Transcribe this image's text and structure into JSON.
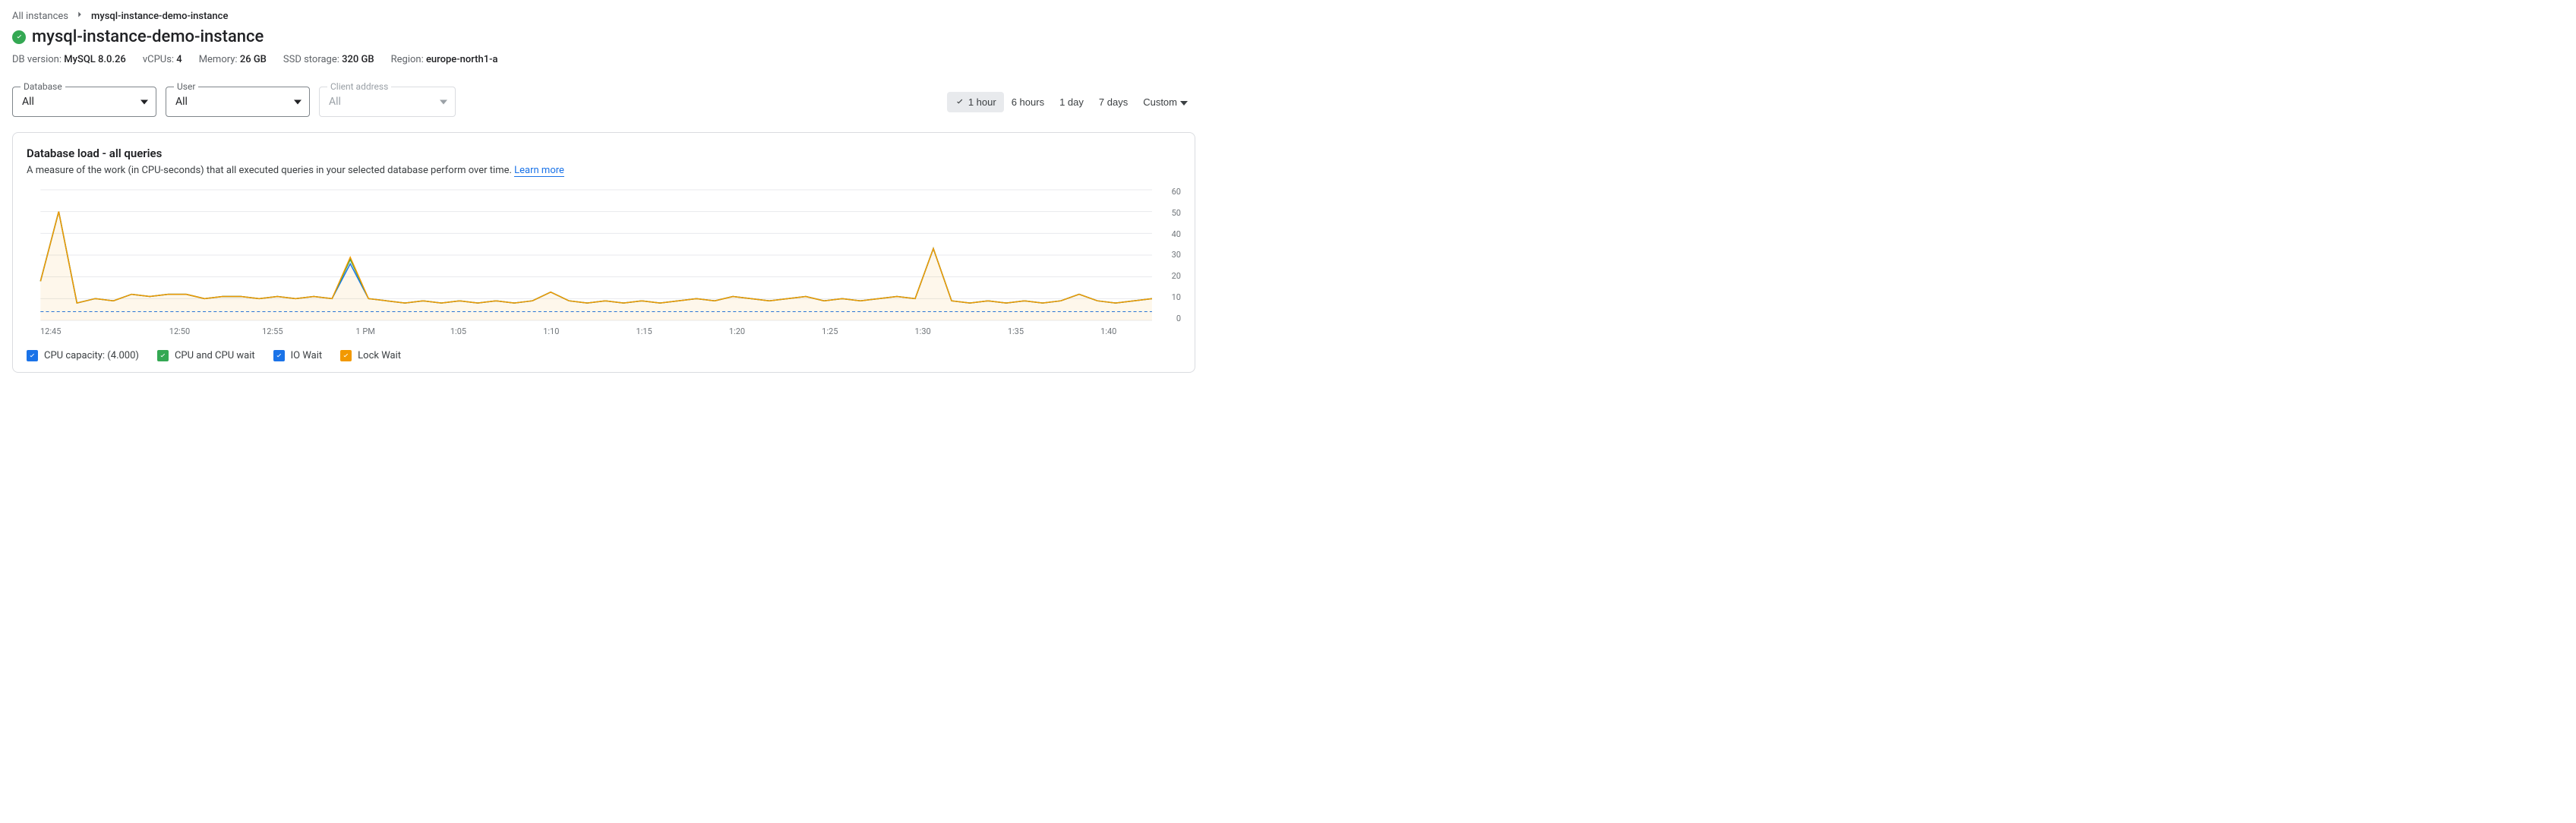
{
  "breadcrumb": {
    "root": "All instances",
    "current": "mysql-instance-demo-instance"
  },
  "title": "mysql-instance-demo-instance",
  "specs": {
    "db_version_label": "DB version:",
    "db_version": "MySQL 8.0.26",
    "vcpus_label": "vCPUs:",
    "vcpus": "4",
    "memory_label": "Memory:",
    "memory": "26 GB",
    "ssd_label": "SSD storage:",
    "ssd": "320 GB",
    "region_label": "Region:",
    "region": "europe-north1-a"
  },
  "filters": {
    "database": {
      "label": "Database",
      "value": "All"
    },
    "user": {
      "label": "User",
      "value": "All"
    },
    "client": {
      "label": "Client address",
      "value": "All"
    }
  },
  "time_ranges": [
    "1 hour",
    "6 hours",
    "1 day",
    "7 days",
    "Custom"
  ],
  "time_range_active": "1 hour",
  "card": {
    "title": "Database load - all queries",
    "desc": "A measure of the work (in CPU-seconds) that all executed queries in your selected database perform over time. ",
    "learn_more": "Learn more"
  },
  "legend": [
    {
      "label": "CPU capacity: (4.000)",
      "color": "#1a73e8"
    },
    {
      "label": "CPU and CPU wait",
      "color": "#34a853"
    },
    {
      "label": "IO Wait",
      "color": "#1a73e8"
    },
    {
      "label": "Lock Wait",
      "color": "#f29900"
    }
  ],
  "chart_data": {
    "type": "area",
    "xlabel": "",
    "ylabel": "",
    "ylim": [
      0,
      60
    ],
    "y_ticks": [
      60,
      50,
      40,
      30,
      20,
      10,
      0
    ],
    "x_ticks": [
      "12:45",
      "12:50",
      "12:55",
      "1 PM",
      "1:05",
      "1:10",
      "1:15",
      "1:20",
      "1:25",
      "1:30",
      "1:35",
      "1:40"
    ],
    "cpu_capacity": 4.0,
    "series": [
      {
        "name": "Lock Wait",
        "color": "#f29900",
        "fill": "rgba(242,153,0,0.08)",
        "values": [
          18,
          50,
          8,
          10,
          9,
          12,
          11,
          12,
          12,
          10,
          11,
          11,
          10,
          11,
          10,
          11,
          10,
          29,
          10,
          9,
          8,
          9,
          8,
          9,
          8,
          9,
          8,
          9,
          13,
          9,
          8,
          9,
          8,
          9,
          8,
          9,
          10,
          9,
          11,
          10,
          9,
          10,
          11,
          9,
          10,
          9,
          10,
          11,
          10,
          33,
          9,
          8,
          9,
          8,
          9,
          8,
          9,
          12,
          9,
          8,
          9,
          10
        ]
      },
      {
        "name": "CPU and CPU wait",
        "color": "#34a853",
        "values": [
          18,
          50,
          8,
          10,
          9,
          12,
          11,
          12,
          12,
          10,
          11,
          11,
          10,
          11,
          10,
          11,
          10,
          28,
          10,
          9,
          8,
          9,
          8,
          9,
          8,
          9,
          8,
          9,
          13,
          9,
          8,
          9,
          8,
          9,
          8,
          9,
          10,
          9,
          11,
          10,
          9,
          10,
          11,
          9,
          10,
          9,
          10,
          11,
          10,
          33,
          9,
          8,
          9,
          8,
          9,
          8,
          9,
          12,
          9,
          8,
          9,
          10
        ]
      },
      {
        "name": "IO Wait",
        "color": "#1a73e8",
        "values": [
          18,
          50,
          8,
          10,
          9,
          12,
          11,
          12,
          12,
          10,
          11,
          11,
          10,
          11,
          10,
          11,
          10,
          26,
          10,
          9,
          8,
          9,
          8,
          9,
          8,
          9,
          8,
          9,
          13,
          9,
          8,
          9,
          8,
          9,
          8,
          9,
          10,
          9,
          11,
          10,
          9,
          10,
          11,
          9,
          10,
          9,
          10,
          11,
          10,
          33,
          9,
          8,
          9,
          8,
          9,
          8,
          9,
          12,
          9,
          8,
          9,
          10
        ]
      }
    ]
  }
}
